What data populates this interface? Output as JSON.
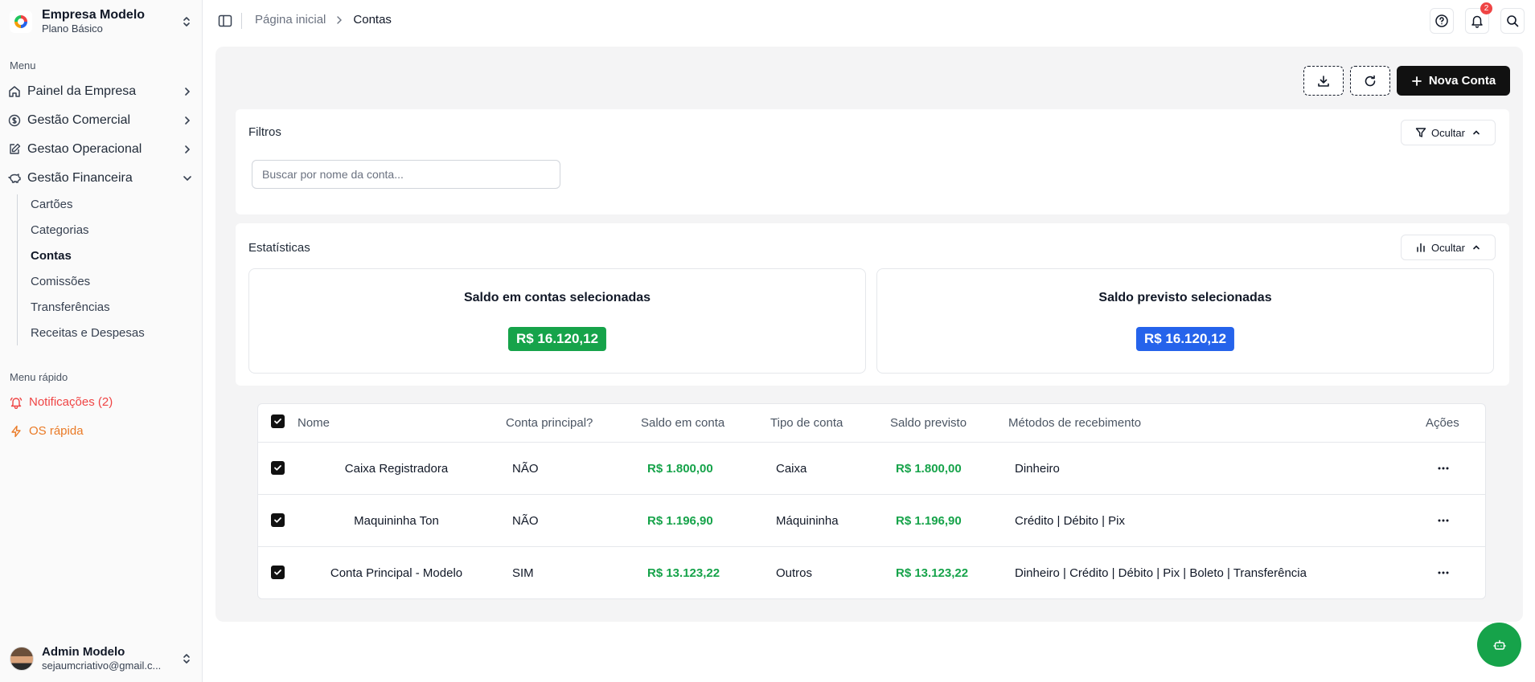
{
  "sidebar": {
    "company_name": "Empresa Modelo",
    "company_plan": "Plano Básico",
    "menu_label": "Menu",
    "items": [
      {
        "label": "Painel da Empresa",
        "icon": "home-icon"
      },
      {
        "label": "Gestão Comercial",
        "icon": "dollar-circle-icon"
      },
      {
        "label": "Gestao Operacional",
        "icon": "edit-icon"
      },
      {
        "label": "Gestão Financeira",
        "icon": "piggy-bank-icon"
      }
    ],
    "sub_items": [
      "Cartões",
      "Categorias",
      "Contas",
      "Comissões",
      "Transferências",
      "Receitas e Despesas"
    ],
    "active_sub_item": "Contas",
    "quick_label": "Menu rápido",
    "quick_items": [
      {
        "label": "Notificações (2)",
        "icon": "bell-ring-icon",
        "color": "#ef4444"
      },
      {
        "label": "OS rápida",
        "icon": "zap-icon",
        "color": "#ea7a26"
      }
    ],
    "user_name": "Admin Modelo",
    "user_email": "sejaumcriativo@gmail.c..."
  },
  "topbar": {
    "breadcrumb_home": "Página inicial",
    "breadcrumb_current": "Contas",
    "notification_count": "2"
  },
  "toolbar": {
    "new_button": "Nova Conta"
  },
  "filters": {
    "title": "Filtros",
    "hide_label": "Ocultar",
    "search_placeholder": "Buscar por nome da conta...",
    "search_value": ""
  },
  "stats": {
    "title": "Estatísticas",
    "hide_label": "Ocultar",
    "cards": [
      {
        "title": "Saldo em contas selecionadas",
        "value": "R$ 16.120,12",
        "color": "#16a34a"
      },
      {
        "title": "Saldo previsto selecionadas",
        "value": "R$ 16.120,12",
        "color": "#2563eb"
      }
    ]
  },
  "table": {
    "headers": [
      "Nome",
      "Conta principal?",
      "Saldo em conta",
      "Tipo de conta",
      "Saldo previsto",
      "Métodos de recebimento",
      "Ações"
    ],
    "rows": [
      {
        "checked": true,
        "name": "Caixa Registradora",
        "principal": "NÃO",
        "saldo": "R$ 1.800,00",
        "tipo": "Caixa",
        "previsto": "R$ 1.800,00",
        "metodos": "Dinheiro"
      },
      {
        "checked": true,
        "name": "Maquininha Ton",
        "principal": "NÃO",
        "saldo": "R$ 1.196,90",
        "tipo": "Máquininha",
        "previsto": "R$ 1.196,90",
        "metodos": "Crédito | Débito | Pix"
      },
      {
        "checked": true,
        "name": "Conta Principal - Modelo",
        "principal": "SIM",
        "saldo": "R$ 13.123,22",
        "tipo": "Outros",
        "previsto": "R$ 13.123,22",
        "metodos": "Dinheiro | Crédito | Débito | Pix | Boleto | Transferência"
      }
    ]
  },
  "colors": {
    "accent": "#111111",
    "money_green": "#16a34a",
    "forecast_blue": "#2563eb",
    "fab_green": "#16a34a"
  }
}
